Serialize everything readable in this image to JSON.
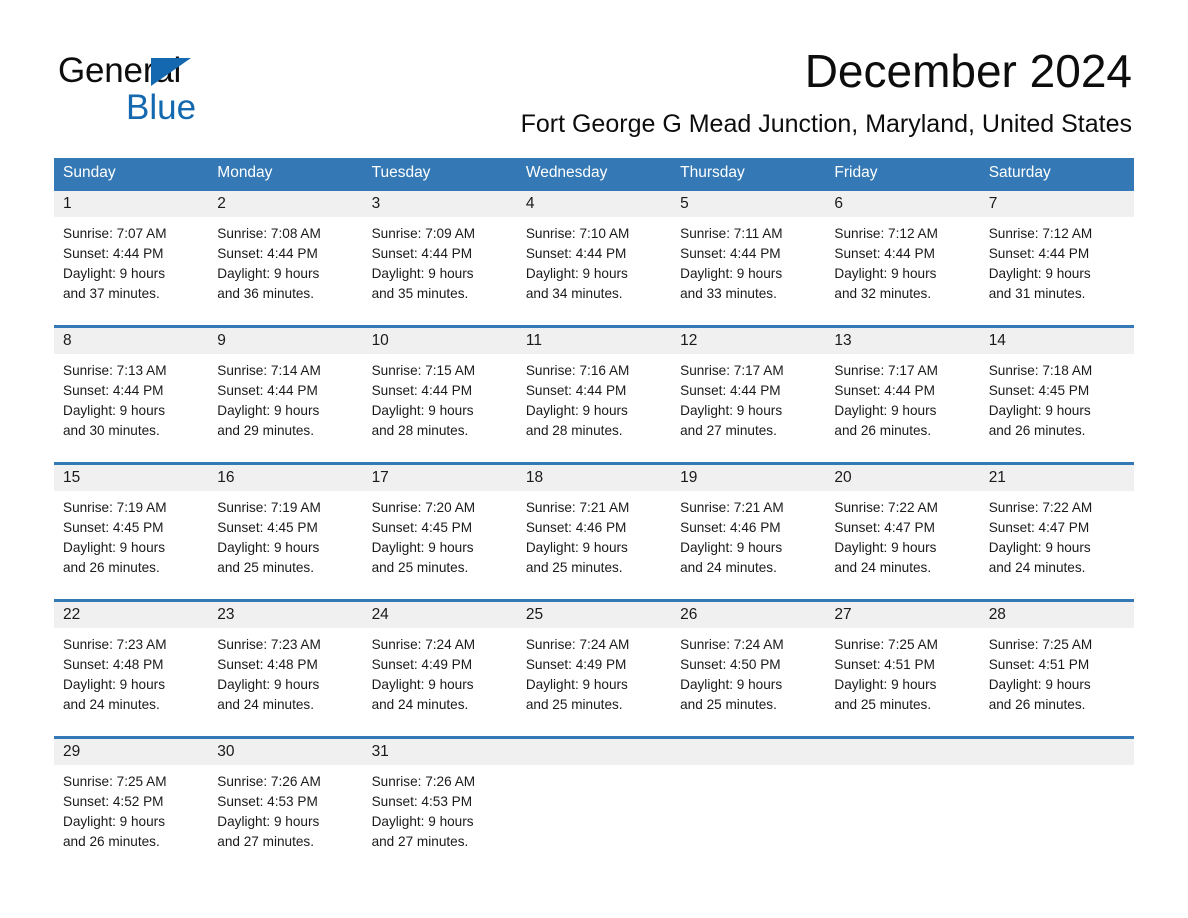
{
  "brand": {
    "line1": "General",
    "line2": "Blue",
    "triangle_color": "#1368b0",
    "text_color": "#0d0d0d"
  },
  "header": {
    "title": "December 2024",
    "location": "Fort George G Mead Junction, Maryland, United States"
  },
  "colors": {
    "header_blue": "#3479b5",
    "daynum_band": "#f0f0f0",
    "body_text": "#1a1a1a",
    "page_background": "#ffffff"
  },
  "weekdays": [
    "Sunday",
    "Monday",
    "Tuesday",
    "Wednesday",
    "Thursday",
    "Friday",
    "Saturday"
  ],
  "weeks": [
    {
      "days": [
        {
          "num": "1",
          "sunrise": "Sunrise: 7:07 AM",
          "sunset": "Sunset: 4:44 PM",
          "daylight1": "Daylight: 9 hours",
          "daylight2": "and 37 minutes."
        },
        {
          "num": "2",
          "sunrise": "Sunrise: 7:08 AM",
          "sunset": "Sunset: 4:44 PM",
          "daylight1": "Daylight: 9 hours",
          "daylight2": "and 36 minutes."
        },
        {
          "num": "3",
          "sunrise": "Sunrise: 7:09 AM",
          "sunset": "Sunset: 4:44 PM",
          "daylight1": "Daylight: 9 hours",
          "daylight2": "and 35 minutes."
        },
        {
          "num": "4",
          "sunrise": "Sunrise: 7:10 AM",
          "sunset": "Sunset: 4:44 PM",
          "daylight1": "Daylight: 9 hours",
          "daylight2": "and 34 minutes."
        },
        {
          "num": "5",
          "sunrise": "Sunrise: 7:11 AM",
          "sunset": "Sunset: 4:44 PM",
          "daylight1": "Daylight: 9 hours",
          "daylight2": "and 33 minutes."
        },
        {
          "num": "6",
          "sunrise": "Sunrise: 7:12 AM",
          "sunset": "Sunset: 4:44 PM",
          "daylight1": "Daylight: 9 hours",
          "daylight2": "and 32 minutes."
        },
        {
          "num": "7",
          "sunrise": "Sunrise: 7:12 AM",
          "sunset": "Sunset: 4:44 PM",
          "daylight1": "Daylight: 9 hours",
          "daylight2": "and 31 minutes."
        }
      ]
    },
    {
      "days": [
        {
          "num": "8",
          "sunrise": "Sunrise: 7:13 AM",
          "sunset": "Sunset: 4:44 PM",
          "daylight1": "Daylight: 9 hours",
          "daylight2": "and 30 minutes."
        },
        {
          "num": "9",
          "sunrise": "Sunrise: 7:14 AM",
          "sunset": "Sunset: 4:44 PM",
          "daylight1": "Daylight: 9 hours",
          "daylight2": "and 29 minutes."
        },
        {
          "num": "10",
          "sunrise": "Sunrise: 7:15 AM",
          "sunset": "Sunset: 4:44 PM",
          "daylight1": "Daylight: 9 hours",
          "daylight2": "and 28 minutes."
        },
        {
          "num": "11",
          "sunrise": "Sunrise: 7:16 AM",
          "sunset": "Sunset: 4:44 PM",
          "daylight1": "Daylight: 9 hours",
          "daylight2": "and 28 minutes."
        },
        {
          "num": "12",
          "sunrise": "Sunrise: 7:17 AM",
          "sunset": "Sunset: 4:44 PM",
          "daylight1": "Daylight: 9 hours",
          "daylight2": "and 27 minutes."
        },
        {
          "num": "13",
          "sunrise": "Sunrise: 7:17 AM",
          "sunset": "Sunset: 4:44 PM",
          "daylight1": "Daylight: 9 hours",
          "daylight2": "and 26 minutes."
        },
        {
          "num": "14",
          "sunrise": "Sunrise: 7:18 AM",
          "sunset": "Sunset: 4:45 PM",
          "daylight1": "Daylight: 9 hours",
          "daylight2": "and 26 minutes."
        }
      ]
    },
    {
      "days": [
        {
          "num": "15",
          "sunrise": "Sunrise: 7:19 AM",
          "sunset": "Sunset: 4:45 PM",
          "daylight1": "Daylight: 9 hours",
          "daylight2": "and 26 minutes."
        },
        {
          "num": "16",
          "sunrise": "Sunrise: 7:19 AM",
          "sunset": "Sunset: 4:45 PM",
          "daylight1": "Daylight: 9 hours",
          "daylight2": "and 25 minutes."
        },
        {
          "num": "17",
          "sunrise": "Sunrise: 7:20 AM",
          "sunset": "Sunset: 4:45 PM",
          "daylight1": "Daylight: 9 hours",
          "daylight2": "and 25 minutes."
        },
        {
          "num": "18",
          "sunrise": "Sunrise: 7:21 AM",
          "sunset": "Sunset: 4:46 PM",
          "daylight1": "Daylight: 9 hours",
          "daylight2": "and 25 minutes."
        },
        {
          "num": "19",
          "sunrise": "Sunrise: 7:21 AM",
          "sunset": "Sunset: 4:46 PM",
          "daylight1": "Daylight: 9 hours",
          "daylight2": "and 24 minutes."
        },
        {
          "num": "20",
          "sunrise": "Sunrise: 7:22 AM",
          "sunset": "Sunset: 4:47 PM",
          "daylight1": "Daylight: 9 hours",
          "daylight2": "and 24 minutes."
        },
        {
          "num": "21",
          "sunrise": "Sunrise: 7:22 AM",
          "sunset": "Sunset: 4:47 PM",
          "daylight1": "Daylight: 9 hours",
          "daylight2": "and 24 minutes."
        }
      ]
    },
    {
      "days": [
        {
          "num": "22",
          "sunrise": "Sunrise: 7:23 AM",
          "sunset": "Sunset: 4:48 PM",
          "daylight1": "Daylight: 9 hours",
          "daylight2": "and 24 minutes."
        },
        {
          "num": "23",
          "sunrise": "Sunrise: 7:23 AM",
          "sunset": "Sunset: 4:48 PM",
          "daylight1": "Daylight: 9 hours",
          "daylight2": "and 24 minutes."
        },
        {
          "num": "24",
          "sunrise": "Sunrise: 7:24 AM",
          "sunset": "Sunset: 4:49 PM",
          "daylight1": "Daylight: 9 hours",
          "daylight2": "and 24 minutes."
        },
        {
          "num": "25",
          "sunrise": "Sunrise: 7:24 AM",
          "sunset": "Sunset: 4:49 PM",
          "daylight1": "Daylight: 9 hours",
          "daylight2": "and 25 minutes."
        },
        {
          "num": "26",
          "sunrise": "Sunrise: 7:24 AM",
          "sunset": "Sunset: 4:50 PM",
          "daylight1": "Daylight: 9 hours",
          "daylight2": "and 25 minutes."
        },
        {
          "num": "27",
          "sunrise": "Sunrise: 7:25 AM",
          "sunset": "Sunset: 4:51 PM",
          "daylight1": "Daylight: 9 hours",
          "daylight2": "and 25 minutes."
        },
        {
          "num": "28",
          "sunrise": "Sunrise: 7:25 AM",
          "sunset": "Sunset: 4:51 PM",
          "daylight1": "Daylight: 9 hours",
          "daylight2": "and 26 minutes."
        }
      ]
    },
    {
      "days": [
        {
          "num": "29",
          "sunrise": "Sunrise: 7:25 AM",
          "sunset": "Sunset: 4:52 PM",
          "daylight1": "Daylight: 9 hours",
          "daylight2": "and 26 minutes."
        },
        {
          "num": "30",
          "sunrise": "Sunrise: 7:26 AM",
          "sunset": "Sunset: 4:53 PM",
          "daylight1": "Daylight: 9 hours",
          "daylight2": "and 27 minutes."
        },
        {
          "num": "31",
          "sunrise": "Sunrise: 7:26 AM",
          "sunset": "Sunset: 4:53 PM",
          "daylight1": "Daylight: 9 hours",
          "daylight2": "and 27 minutes."
        },
        {
          "num": "",
          "sunrise": "",
          "sunset": "",
          "daylight1": "",
          "daylight2": ""
        },
        {
          "num": "",
          "sunrise": "",
          "sunset": "",
          "daylight1": "",
          "daylight2": ""
        },
        {
          "num": "",
          "sunrise": "",
          "sunset": "",
          "daylight1": "",
          "daylight2": ""
        },
        {
          "num": "",
          "sunrise": "",
          "sunset": "",
          "daylight1": "",
          "daylight2": ""
        }
      ]
    }
  ]
}
